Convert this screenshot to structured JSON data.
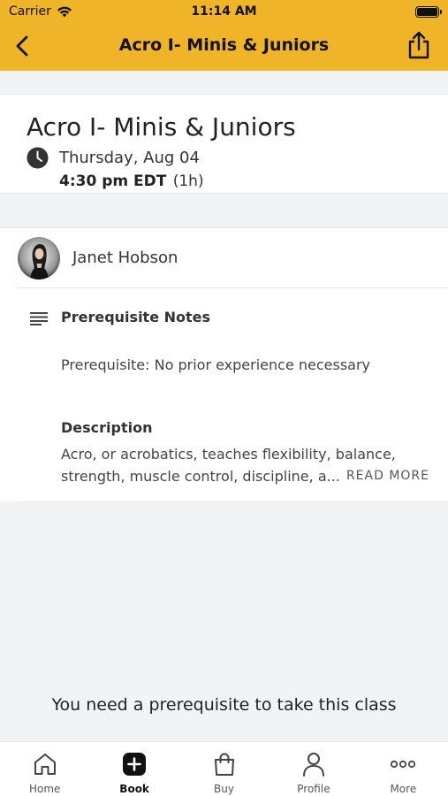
{
  "status_bar": {
    "carrier": "Carrier",
    "time": "11:14 AM"
  },
  "nav": {
    "title": "Acro I- Minis & Juniors"
  },
  "class_info": {
    "title": "Acro I- Minis & Juniors",
    "date": "Thursday, Aug 04",
    "time": "4:30 pm EDT",
    "duration": "(1h)"
  },
  "instructor": {
    "name": "Janet Hobson"
  },
  "prerequisite_notes": {
    "heading": "Prerequisite Notes",
    "text": "Prerequisite: No prior experience necessary"
  },
  "description": {
    "heading": "Description",
    "line1": "Acro, or acrobatics, teaches flexibility, balance,",
    "line2": "strength, muscle control, discipline, a...",
    "read_more": "READ MORE"
  },
  "banner": {
    "text": "You need a prerequisite to take this class"
  },
  "tab_bar": {
    "active": "Book",
    "items": [
      {
        "label": "Home",
        "icon": "home-icon"
      },
      {
        "label": "Book",
        "icon": "plus-square-icon"
      },
      {
        "label": "Buy",
        "icon": "shopping-bag-icon"
      },
      {
        "label": "Profile",
        "icon": "person-icon"
      },
      {
        "label": "More",
        "icon": "more-dots-icon"
      }
    ]
  },
  "colors": {
    "header": "#f0b429",
    "background": "#f2f3f5"
  }
}
